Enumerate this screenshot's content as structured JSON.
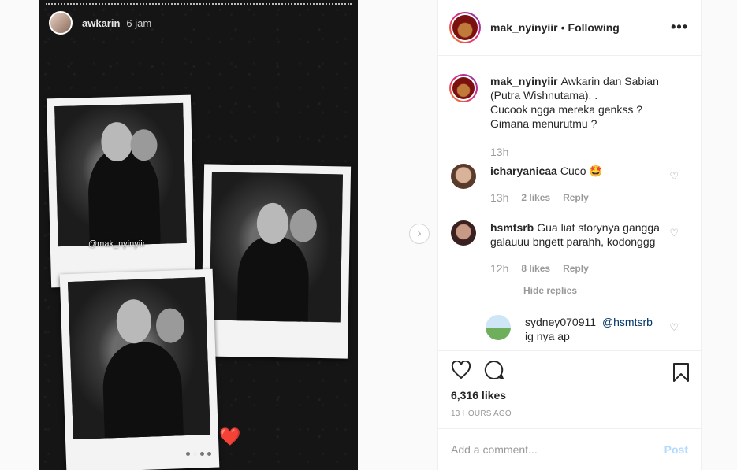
{
  "story": {
    "username": "awkarin",
    "time": "6 jam",
    "watermark": "@mak_nyinyiir",
    "heart": "❤️"
  },
  "post": {
    "author": "mak_nyinyiir",
    "separator": "•",
    "follow_status": "Following",
    "caption_lines": [
      "Awkarin dan Sabian (Putra Wishnutama). .",
      "Cucook ngga mereka genkss ?",
      "Gimana menurutmu ?"
    ],
    "caption_time": "13h",
    "likes": "6,316 likes",
    "posted_ago": "13 HOURS AGO"
  },
  "comments": [
    {
      "user": "icharyanicaa",
      "text": "Cuco 🤩",
      "time": "13h",
      "likes": "2 likes",
      "reply": "Reply"
    },
    {
      "user": "hsmtsrb",
      "text": "Gua liat storynya gangga galauuu bngett parahh, kodonggg",
      "time": "12h",
      "likes": "8 likes",
      "reply": "Reply",
      "hide_replies": "Hide replies"
    }
  ],
  "reply": {
    "user": "sydney070911",
    "mention": "@hsmtsrb",
    "text": "ig nya ap"
  },
  "add_comment": {
    "placeholder": "Add a comment...",
    "post_label": "Post"
  },
  "colors": {
    "link": "#003569",
    "post_disabled": "#b3dbff",
    "muted": "#999999"
  }
}
